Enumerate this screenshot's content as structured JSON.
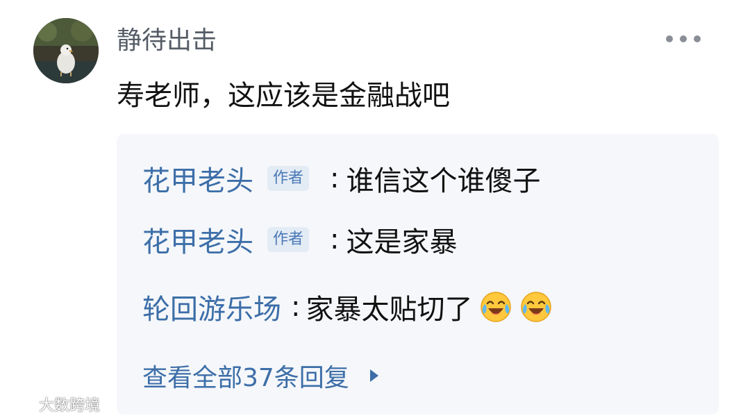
{
  "comment": {
    "username": "静待出击",
    "text": "寿老师，这应该是金融战吧"
  },
  "more_icon": "more-horizontal-icon",
  "replies": [
    {
      "author": "花甲老头",
      "tag": "作者",
      "colon": ":",
      "text": "谁信这个谁傻子"
    },
    {
      "author": "花甲老头",
      "tag": "作者",
      "colon": ":",
      "text": "这是家暴"
    },
    {
      "author": "轮回游乐场",
      "colon": ":",
      "text": "家暴太贴切了",
      "emojis": [
        "laughing-crying-face-icon",
        "laughing-crying-face-icon"
      ]
    }
  ],
  "view_all": {
    "label": "查看全部37条回复",
    "icon": "triangle-right-icon"
  },
  "watermark": {
    "text": "大数跨境"
  },
  "colors": {
    "link_blue": "#3c6ea8",
    "reply_bg": "#f5f7fa",
    "tag_bg": "#e3ebf5"
  }
}
